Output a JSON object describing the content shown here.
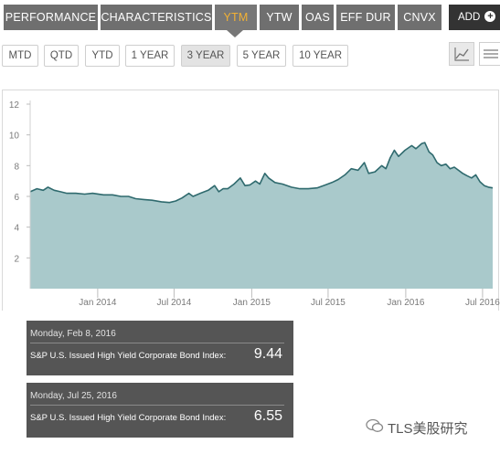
{
  "tabs": [
    {
      "label": "PERFORMANCE",
      "active": false
    },
    {
      "label": "CHARACTERISTICS",
      "active": false
    },
    {
      "label": "YTM",
      "active": true
    },
    {
      "label": "YTW",
      "active": false
    },
    {
      "label": "OAS",
      "active": false
    },
    {
      "label": "EFF DUR",
      "active": false
    },
    {
      "label": "CNVX",
      "active": false
    }
  ],
  "add_button": {
    "label": "ADD",
    "icon": "plus-circle-icon"
  },
  "periods": [
    {
      "label": "MTD",
      "active": false
    },
    {
      "label": "QTD",
      "active": false
    },
    {
      "label": "YTD",
      "active": false
    },
    {
      "label": "1 YEAR",
      "active": false
    },
    {
      "label": "3 YEAR",
      "active": true
    },
    {
      "label": "5 YEAR",
      "active": false
    },
    {
      "label": "10 YEAR",
      "active": false
    }
  ],
  "view_buttons": [
    {
      "name": "line-chart-icon",
      "active": true
    },
    {
      "name": "table-icon",
      "active": false
    }
  ],
  "colors": {
    "accent": "#f2b134",
    "tab_bg": "#6f6f6f",
    "area_fill": "#a9c9cb",
    "line": "#2f6a6e",
    "tooltip_bg": "#555555"
  },
  "chart_data": {
    "type": "area",
    "title": "",
    "xlabel": "",
    "ylabel": "",
    "y_ticks": [
      2,
      4,
      6,
      8,
      10,
      12
    ],
    "ylim": [
      0,
      12
    ],
    "x_tick_labels": [
      "Jan 2014",
      "Jul 2014",
      "Jan 2015",
      "Jul 2015",
      "Jan 2016",
      "Jul 2016"
    ],
    "x_tick_dates": [
      "2014-01-01",
      "2014-07-01",
      "2015-01-01",
      "2015-07-01",
      "2016-01-01",
      "2016-07-01"
    ],
    "xlim": [
      "2013-07-25",
      "2016-07-25"
    ],
    "grid": false,
    "series": [
      {
        "points": [
          [
            "2013-07-25",
            6.3
          ],
          [
            "2013-08-10",
            6.5
          ],
          [
            "2013-08-25",
            6.4
          ],
          [
            "2013-09-05",
            6.6
          ],
          [
            "2013-09-20",
            6.4
          ],
          [
            "2013-10-05",
            6.3
          ],
          [
            "2013-10-20",
            6.2
          ],
          [
            "2013-11-10",
            6.2
          ],
          [
            "2013-12-01",
            6.15
          ],
          [
            "2013-12-20",
            6.2
          ],
          [
            "2014-01-15",
            6.1
          ],
          [
            "2014-02-05",
            6.1
          ],
          [
            "2014-02-25",
            6.0
          ],
          [
            "2014-03-15",
            6.0
          ],
          [
            "2014-04-01",
            5.85
          ],
          [
            "2014-04-20",
            5.8
          ],
          [
            "2014-05-10",
            5.75
          ],
          [
            "2014-06-01",
            5.65
          ],
          [
            "2014-06-20",
            5.6
          ],
          [
            "2014-07-05",
            5.7
          ],
          [
            "2014-07-20",
            5.9
          ],
          [
            "2014-08-05",
            6.2
          ],
          [
            "2014-08-15",
            6.0
          ],
          [
            "2014-09-01",
            6.2
          ],
          [
            "2014-09-20",
            6.4
          ],
          [
            "2014-10-05",
            6.7
          ],
          [
            "2014-10-15",
            6.3
          ],
          [
            "2014-10-25",
            6.5
          ],
          [
            "2014-11-05",
            6.5
          ],
          [
            "2014-11-20",
            6.8
          ],
          [
            "2014-12-05",
            7.2
          ],
          [
            "2014-12-16",
            6.7
          ],
          [
            "2014-12-28",
            6.75
          ],
          [
            "2015-01-10",
            7.0
          ],
          [
            "2015-01-20",
            6.8
          ],
          [
            "2015-02-01",
            7.5
          ],
          [
            "2015-02-10",
            7.2
          ],
          [
            "2015-02-25",
            6.9
          ],
          [
            "2015-03-15",
            6.8
          ],
          [
            "2015-04-05",
            6.6
          ],
          [
            "2015-04-25",
            6.5
          ],
          [
            "2015-05-15",
            6.5
          ],
          [
            "2015-06-05",
            6.55
          ],
          [
            "2015-06-25",
            6.75
          ],
          [
            "2015-07-10",
            6.9
          ],
          [
            "2015-07-25",
            7.1
          ],
          [
            "2015-08-10",
            7.4
          ],
          [
            "2015-08-25",
            7.8
          ],
          [
            "2015-09-10",
            7.7
          ],
          [
            "2015-09-25",
            8.2
          ],
          [
            "2015-10-05",
            7.5
          ],
          [
            "2015-10-20",
            7.6
          ],
          [
            "2015-11-05",
            8.0
          ],
          [
            "2015-11-15",
            7.8
          ],
          [
            "2015-11-25",
            8.5
          ],
          [
            "2015-12-05",
            9.0
          ],
          [
            "2015-12-15",
            8.6
          ],
          [
            "2015-12-30",
            9.0
          ],
          [
            "2016-01-15",
            9.3
          ],
          [
            "2016-01-25",
            9.1
          ],
          [
            "2016-02-08",
            9.44
          ],
          [
            "2016-02-15",
            9.5
          ],
          [
            "2016-02-25",
            8.9
          ],
          [
            "2016-03-05",
            8.7
          ],
          [
            "2016-03-15",
            8.2
          ],
          [
            "2016-03-25",
            8.0
          ],
          [
            "2016-04-05",
            8.1
          ],
          [
            "2016-04-15",
            7.8
          ],
          [
            "2016-04-25",
            7.9
          ],
          [
            "2016-05-05",
            7.7
          ],
          [
            "2016-05-15",
            7.5
          ],
          [
            "2016-05-25",
            7.35
          ],
          [
            "2016-06-05",
            7.2
          ],
          [
            "2016-06-15",
            7.4
          ],
          [
            "2016-06-25",
            6.95
          ],
          [
            "2016-07-05",
            6.7
          ],
          [
            "2016-07-15",
            6.6
          ],
          [
            "2016-07-25",
            6.55
          ]
        ]
      }
    ]
  },
  "tooltips": [
    {
      "date": "Monday, Feb 8, 2016",
      "label": "S&P U.S. Issued High Yield Corporate Bond Index:",
      "value": "9.44"
    },
    {
      "date": "Monday, Jul 25, 2016",
      "label": "S&P U.S. Issued High Yield Corporate Bond Index:",
      "value": "6.55"
    }
  ],
  "watermark": {
    "text": "TLS美股研究",
    "icon": "wechat-icon"
  }
}
